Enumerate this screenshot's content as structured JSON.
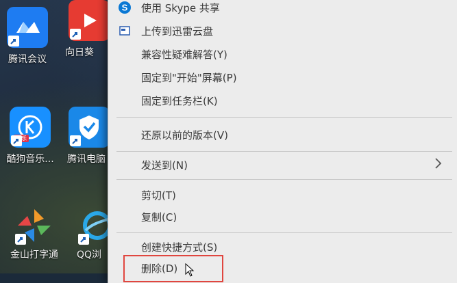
{
  "desktop": {
    "icons": [
      {
        "name": "desktop-icon-tencent-meeting",
        "label": "腾讯会议",
        "color": "#1e7cf2"
      },
      {
        "name": "desktop-icon-sunflower",
        "label": "向日葵",
        "color": "#e63b32"
      },
      {
        "name": "desktop-icon-kugou",
        "label": "酷狗音乐...",
        "color": "#1890ff"
      },
      {
        "name": "desktop-icon-tencent-pcmgr",
        "label": "腾讯电脑",
        "color": "#1a88e8"
      },
      {
        "name": "desktop-icon-kingsoft-typing",
        "label": "金山打字通",
        "color": "#f19a2a"
      },
      {
        "name": "desktop-icon-qq-browser",
        "label": "QQ浏",
        "color": "#2aa8e8"
      }
    ],
    "kugou_badge": "音乐"
  },
  "context_menu": {
    "items": [
      {
        "label": "使用 Skype 共享",
        "icon": "skype-icon"
      },
      {
        "label": "上传到迅雷云盘",
        "icon": "xunlei-icon"
      },
      {
        "label": "兼容性疑难解答(Y)"
      },
      {
        "label": "固定到\"开始\"屏幕(P)"
      },
      {
        "label": "固定到任务栏(K)"
      },
      {
        "label": "还原以前的版本(V)"
      },
      {
        "label": "发送到(N)",
        "submenu": true
      },
      {
        "label": "剪切(T)"
      },
      {
        "label": "复制(C)"
      },
      {
        "label": "创建快捷方式(S)"
      },
      {
        "label": "删除(D)",
        "highlighted": true
      }
    ]
  },
  "colors": {
    "menu_bg": "#ececec",
    "highlight_border": "#e0463f",
    "skype_blue": "#0a78d4"
  }
}
